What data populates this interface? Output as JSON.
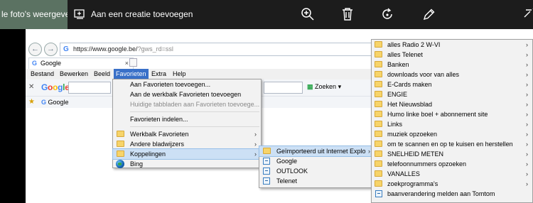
{
  "photo_toolbar": {
    "view_all_label": "le foto's weergeven",
    "add_creation_label": "Aan een creatie toevoegen"
  },
  "browser": {
    "url_main": "https://www.google.be/",
    "url_rest": "?gws_rd=ssl",
    "tab_title": "Google",
    "menu": [
      "Bestand",
      "Bewerken",
      "Beeld",
      "Favorieten",
      "Extra",
      "Help"
    ],
    "search_button": "Zoeken",
    "google_logo": "Google",
    "favorites_bar_item": "Google"
  },
  "favorites_menu": {
    "items": [
      {
        "label": "Aan Favorieten toevoegen...",
        "icon": "",
        "arrow": false,
        "disabled": false
      },
      {
        "label": "Aan de werkbalk Favorieten toevoegen",
        "icon": "",
        "arrow": false,
        "disabled": false
      },
      {
        "label": "Huidige tabbladen aan Favorieten toevoege...",
        "icon": "",
        "arrow": false,
        "disabled": true
      },
      {
        "sep": true
      },
      {
        "label": "Favorieten indelen...",
        "icon": "",
        "arrow": false,
        "disabled": false
      },
      {
        "sep": true
      },
      {
        "label": "Werkbalk Favorieten",
        "icon": "folder-icon",
        "arrow": true,
        "disabled": false
      },
      {
        "label": "Andere bladwijzers",
        "icon": "folder-icon",
        "arrow": true,
        "disabled": false
      },
      {
        "label": "Koppelingen",
        "icon": "folder-icon",
        "arrow": true,
        "disabled": false,
        "selected": true
      },
      {
        "label": "Bing",
        "icon": "globe-icon",
        "arrow": false,
        "disabled": false
      }
    ]
  },
  "links_menu": {
    "items": [
      {
        "label": "Geïmporteerd uit Internet Explo",
        "icon": "folder-icon",
        "arrow": true,
        "selected": true
      },
      {
        "label": "Google",
        "icon": "ie-page-icon",
        "arrow": false
      },
      {
        "label": "OUTLOOK",
        "icon": "ie-page-icon",
        "arrow": false
      },
      {
        "label": "Telenet",
        "icon": "ie-page-icon",
        "arrow": false
      }
    ]
  },
  "imported_menu": {
    "items": [
      {
        "label": "alles Radio 2 W-VI",
        "icon": "folder-icon",
        "arrow": true
      },
      {
        "label": "alles Telenet",
        "icon": "folder-icon",
        "arrow": true
      },
      {
        "label": "Banken",
        "icon": "folder-icon",
        "arrow": true
      },
      {
        "label": "downloads voor van alles",
        "icon": "folder-icon",
        "arrow": true
      },
      {
        "label": "E-Cards maken",
        "icon": "folder-icon",
        "arrow": true
      },
      {
        "label": "ENGIE",
        "icon": "folder-icon",
        "arrow": true
      },
      {
        "label": "Het Nieuwsblad",
        "icon": "folder-icon",
        "arrow": true
      },
      {
        "label": "Humo linke boel + abonnement site",
        "icon": "folder-icon",
        "arrow": true
      },
      {
        "label": "Links",
        "icon": "folder-icon",
        "arrow": true
      },
      {
        "label": "muziek opzoeken",
        "icon": "folder-icon",
        "arrow": true
      },
      {
        "label": "om te scannen en op te kuisen en herstellen",
        "icon": "folder-icon",
        "arrow": true
      },
      {
        "label": "SNELHEID METEN",
        "icon": "folder-icon",
        "arrow": true
      },
      {
        "label": "telefoonnummers opzoeken",
        "icon": "folder-icon",
        "arrow": true
      },
      {
        "label": "VANALLES",
        "icon": "folder-icon",
        "arrow": true
      },
      {
        "label": "zoekprogramma's",
        "icon": "folder-icon",
        "arrow": true
      },
      {
        "label": "baanverandering melden aan Tomtom",
        "icon": "ie-page-icon",
        "arrow": false
      }
    ]
  }
}
